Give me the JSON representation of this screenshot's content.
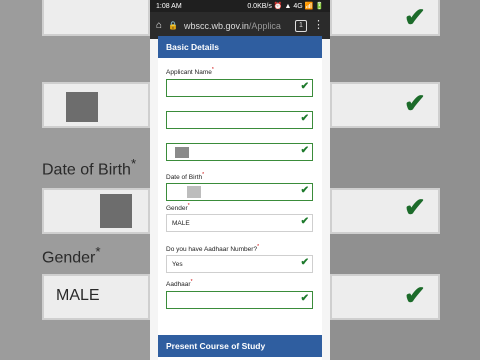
{
  "statusbar": {
    "time": "1:08 AM",
    "right": "0.0KB/s ⏰ ▲ 4G 📶 🔋"
  },
  "browser": {
    "url_host": "wbscc.wb.gov.in",
    "url_path": "/Applica",
    "tab_count": "1"
  },
  "sections": {
    "basic": "Basic Details",
    "course": "Present Course of Study"
  },
  "form": {
    "applicant_name_label": "Applicant Name",
    "dob_label": "Date of Birth",
    "gender_label": "Gender",
    "gender_value": "MALE",
    "aadhaar_q_label": "Do you have Aadhaar Number?",
    "aadhaar_q_value": "Yes",
    "aadhaar_label": "Aadhaar",
    "required_mark": "*"
  },
  "background": {
    "dob_label": "Date of Birth",
    "gender_label": "Gender",
    "gender_value": "MALE"
  },
  "icons": {
    "check": "✔"
  }
}
